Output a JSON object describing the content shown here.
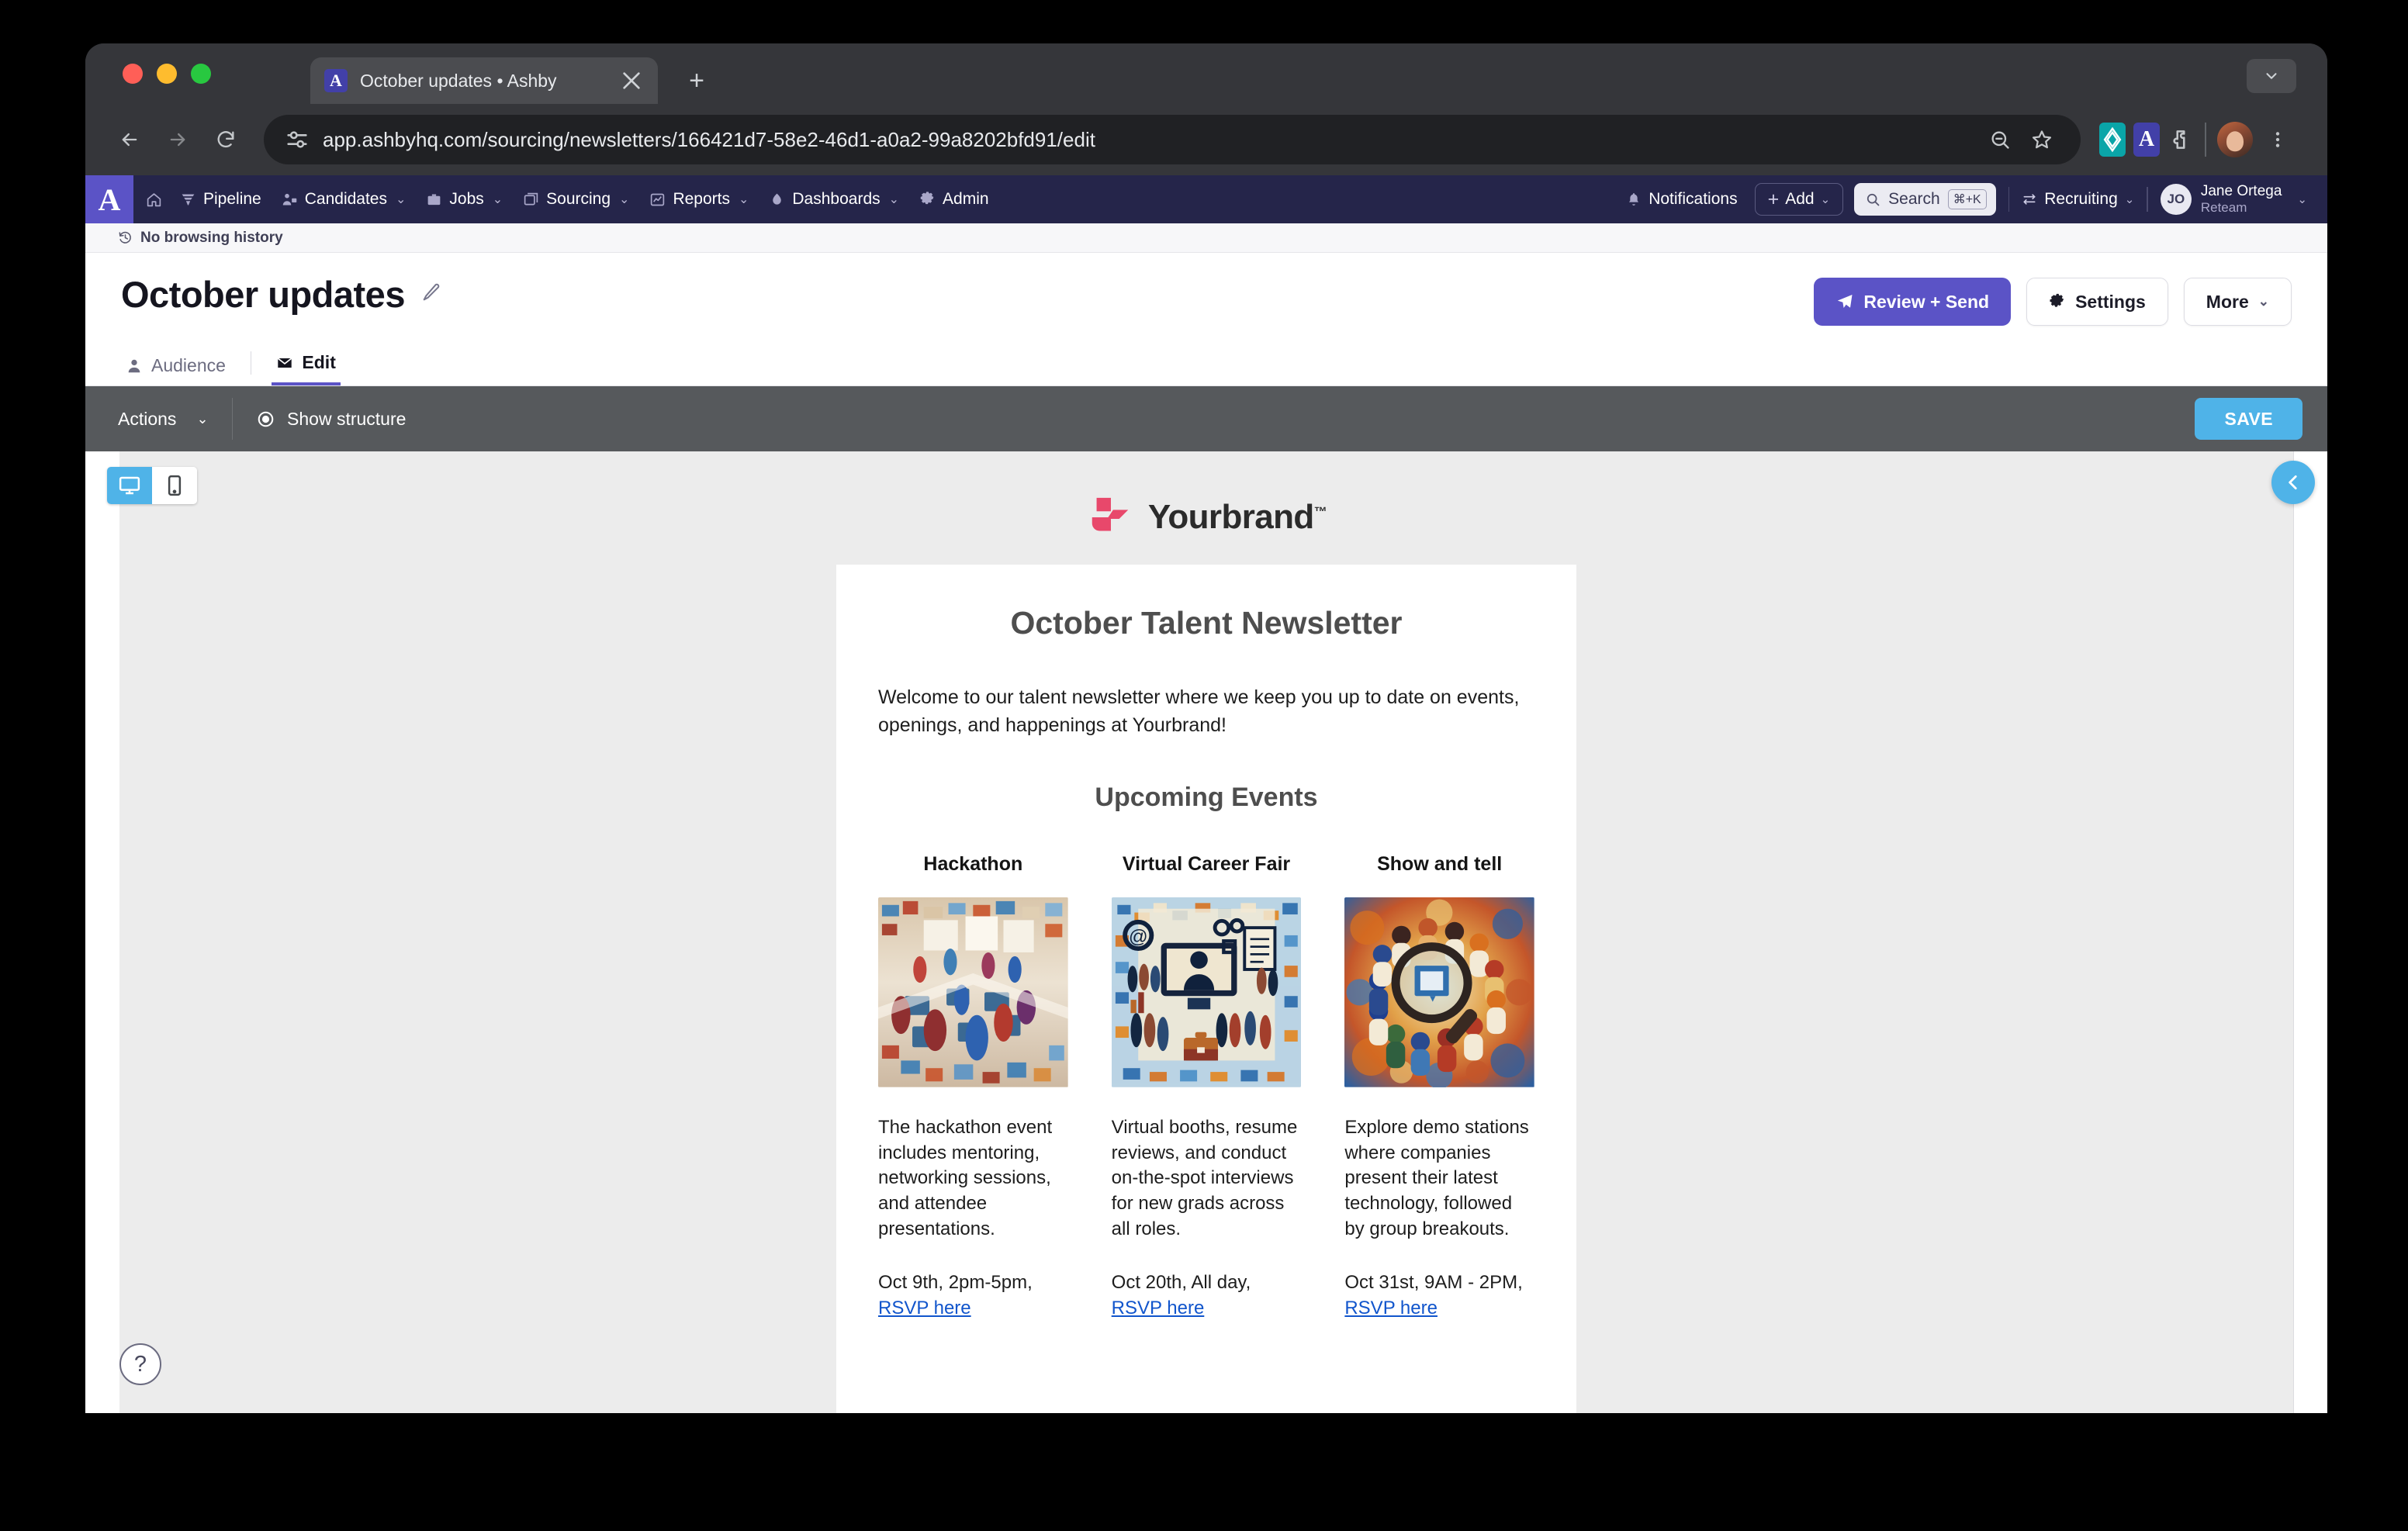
{
  "browser": {
    "tab": {
      "title": "October updates • Ashby",
      "favicon_letter": "A",
      "close_icon": "close-icon"
    },
    "new_tab_label": "+",
    "url": "app.ashbyhq.com/sourcing/newsletters/166421d7-58e2-46d1-a0a2-99a8202bfd91/edit",
    "icons": {
      "back": "back-arrow-icon",
      "forward": "forward-arrow-icon",
      "reload": "reload-icon",
      "site_info": "site-settings-icon",
      "zoom_out": "zoom-out-icon",
      "bookmark": "bookmark-star-icon",
      "extension_teal": "extension-icon",
      "extension_ashby": "ashby-extension-icon",
      "extensions_puzzle": "extensions-puzzle-icon",
      "profile": "profile-avatar",
      "menu": "browser-menu-icon"
    }
  },
  "nav": {
    "logo_letter": "A",
    "items": [
      {
        "label": "Pipeline",
        "icon": "funnel-icon",
        "caret": false
      },
      {
        "label": "Candidates",
        "icon": "candidates-icon",
        "caret": true
      },
      {
        "label": "Jobs",
        "icon": "briefcase-icon",
        "caret": true
      },
      {
        "label": "Sourcing",
        "icon": "sourcing-icon",
        "caret": true
      },
      {
        "label": "Reports",
        "icon": "chart-line-icon",
        "caret": true
      },
      {
        "label": "Dashboards",
        "icon": "dashboard-icon",
        "caret": true
      },
      {
        "label": "Admin",
        "icon": "gear-icon",
        "caret": false
      }
    ],
    "notifications_label": "Notifications",
    "add_label": "Add",
    "search_label": "Search",
    "search_shortcut": "⌘+K",
    "recruiting_label": "Recruiting",
    "user": {
      "initials": "JO",
      "name": "Jane Ortega",
      "org": "Reteam"
    }
  },
  "history_bar": {
    "text": "No browsing history",
    "icon": "history-icon"
  },
  "page": {
    "title": "October updates",
    "edit_icon": "pencil-icon",
    "actions": {
      "review_send": "Review + Send",
      "settings": "Settings",
      "more": "More"
    },
    "tabs": [
      {
        "label": "Audience",
        "icon": "person-icon",
        "active": false
      },
      {
        "label": "Edit",
        "icon": "envelope-icon",
        "active": true
      }
    ]
  },
  "editor_toolbar": {
    "actions_label": "Actions",
    "show_structure_label": "Show structure",
    "save_label": "SAVE"
  },
  "preview": {
    "device_desktop": "desktop-icon",
    "device_mobile": "mobile-icon",
    "collapse_icon": "chevron-left-icon",
    "help_label": "?"
  },
  "newsletter": {
    "brand_name": "Yourbrand",
    "brand_tm": "™",
    "brand_color": "#e8486b",
    "title": "October Talent Newsletter",
    "intro": "Welcome to our talent newsletter where we keep you up to date on events, openings, and happenings at Yourbrand!",
    "section_title": "Upcoming Events",
    "events": [
      {
        "name": "Hackathon",
        "image_alt": "hackathon-illustration",
        "description": "The hackathon event includes mentoring, networking sessions, and attendee presentations.",
        "when": "Oct 9th, 2pm-5pm, ",
        "rsvp": "RSVP here"
      },
      {
        "name": "Virtual Career Fair",
        "image_alt": "virtual-career-fair-illustration",
        "description": "Virtual booths, resume reviews, and conduct on-the-spot interviews for new grads across all roles.",
        "when": "Oct 20th, All day, ",
        "rsvp": "RSVP here"
      },
      {
        "name": "Show and tell",
        "image_alt": "show-and-tell-illustration",
        "description": "Explore demo stations where companies present their latest technology, followed by group breakouts.",
        "when": "Oct 31st, 9AM - 2PM, ",
        "rsvp": "RSVP here"
      }
    ]
  },
  "colors": {
    "ashby_nav": "#25254a",
    "ashby_purple": "#5b53c6",
    "save_blue": "#4fb3e8",
    "editor_toolbar": "#56595c",
    "link_blue": "#1155cc"
  }
}
